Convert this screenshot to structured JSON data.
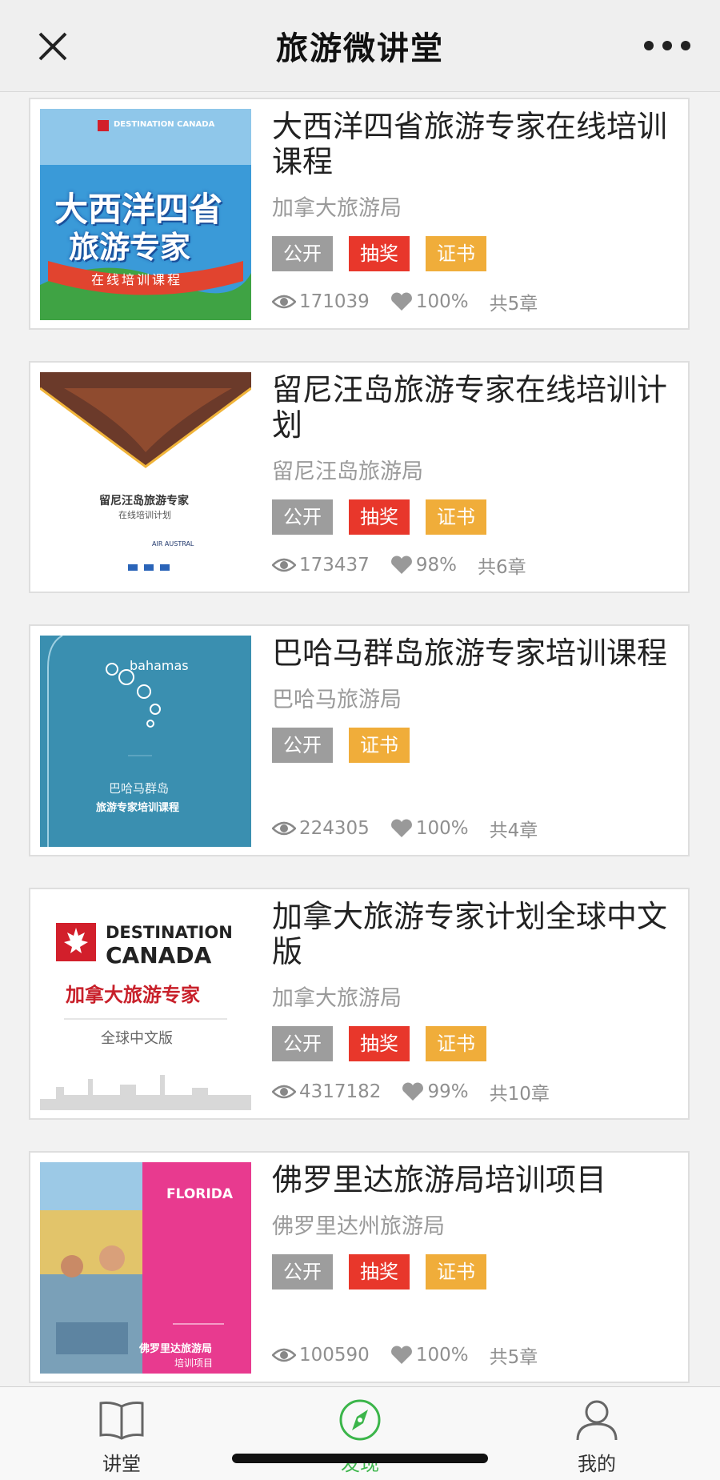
{
  "header": {
    "title": "旅游微讲堂"
  },
  "courses": [
    {
      "title": "大西洋四省旅游专家在线培训课程",
      "org": "加拿大旅游局",
      "tags": [
        {
          "label": "公开",
          "color": "gray"
        },
        {
          "label": "抽奖",
          "color": "red"
        },
        {
          "label": "证书",
          "color": "orange"
        }
      ],
      "views": "171039",
      "likes": "100%",
      "chapters": "共5章",
      "thumb": {
        "line1": "大西洋四省",
        "line2": "旅游专家",
        "ribbon": "在线培训课程",
        "brand": "DESTINATION CANADA"
      }
    },
    {
      "title": "留尼汪岛旅游专家在线培训计划",
      "org": "留尼汪岛旅游局",
      "tags": [
        {
          "label": "公开",
          "color": "gray"
        },
        {
          "label": "抽奖",
          "color": "red"
        },
        {
          "label": "证书",
          "color": "orange"
        }
      ],
      "views": "173437",
      "likes": "98%",
      "chapters": "共6章",
      "thumb": {
        "line1": "留尼汪岛旅游专家",
        "line2": "在线培训计划",
        "brand": "AIR AUSTRAL"
      }
    },
    {
      "title": "巴哈马群岛旅游专家培训课程",
      "org": "巴哈马旅游局",
      "tags": [
        {
          "label": "公开",
          "color": "gray"
        },
        {
          "label": "证书",
          "color": "orange"
        }
      ],
      "views": "224305",
      "likes": "100%",
      "chapters": "共4章",
      "thumb": {
        "brand": "bahamas",
        "line1": "巴哈马群岛",
        "line2": "旅游专家培训课程"
      }
    },
    {
      "title": "加拿大旅游专家计划全球中文版",
      "org": "加拿大旅游局",
      "tags": [
        {
          "label": "公开",
          "color": "gray"
        },
        {
          "label": "抽奖",
          "color": "red"
        },
        {
          "label": "证书",
          "color": "orange"
        }
      ],
      "views": "4317182",
      "likes": "99%",
      "chapters": "共10章",
      "thumb": {
        "brand1": "DESTINATION",
        "brand2": "CANADA",
        "line1": "加拿大旅游专家",
        "line2": "全球中文版"
      }
    },
    {
      "title": "佛罗里达旅游局培训项目",
      "org": "佛罗里达州旅游局",
      "tags": [
        {
          "label": "公开",
          "color": "gray"
        },
        {
          "label": "抽奖",
          "color": "red"
        },
        {
          "label": "证书",
          "color": "orange"
        }
      ],
      "views": "100590",
      "likes": "100%",
      "chapters": "共5章",
      "thumb": {
        "brand": "FLORIDA",
        "line1": "佛罗里达旅游局",
        "line2": "培训项目"
      }
    }
  ],
  "tabbar": {
    "tabs": [
      {
        "label": "讲堂",
        "icon": "book-icon"
      },
      {
        "label": "发现",
        "icon": "compass-icon",
        "active": true
      },
      {
        "label": "我的",
        "icon": "user-icon"
      }
    ]
  },
  "colors": {
    "accent": "#3bb54a",
    "tag_gray": "#9d9d9d",
    "tag_red": "#e8372b",
    "tag_orange": "#f0ad3a"
  }
}
